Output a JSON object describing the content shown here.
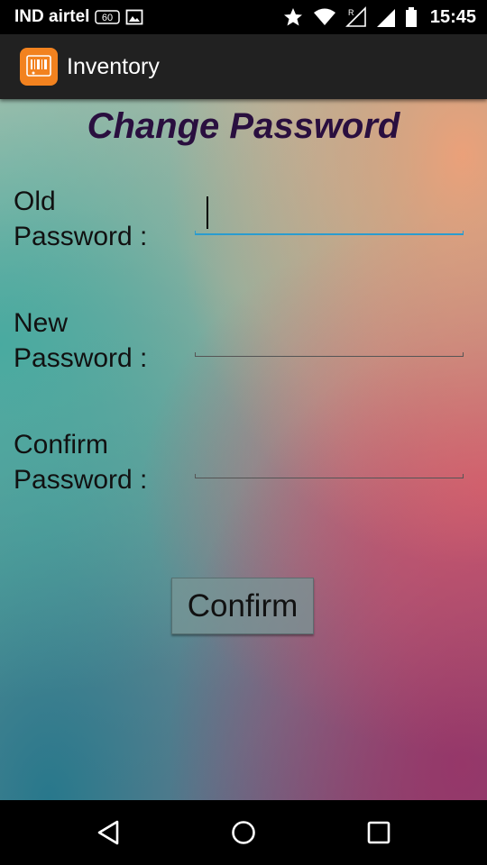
{
  "status_bar": {
    "carrier": "IND airtel",
    "network_badge": "60",
    "time": "15:45",
    "roaming_label": "R",
    "icons": [
      "network-60-icon",
      "image-icon",
      "star-icon",
      "wifi-icon",
      "signal-icon",
      "battery-icon"
    ]
  },
  "action_bar": {
    "app_title": "Inventory",
    "app_icon": "barcode-icon",
    "app_icon_color": "#f2821f"
  },
  "form": {
    "title": "Change Password",
    "old_password": {
      "label_line1": "Old",
      "label_line2": "Password :",
      "value": ""
    },
    "new_password": {
      "label_line1": "New",
      "label_line2": "Password :",
      "value": ""
    },
    "confirm_password": {
      "label_line1": "Confirm",
      "label_line2": "Password :",
      "value": ""
    },
    "confirm_button": "Confirm",
    "accent_color": "#2a9ccf",
    "title_color": "#2a0f3f"
  },
  "nav_bar": {
    "icons": [
      "back-icon",
      "home-icon",
      "recents-icon"
    ]
  }
}
